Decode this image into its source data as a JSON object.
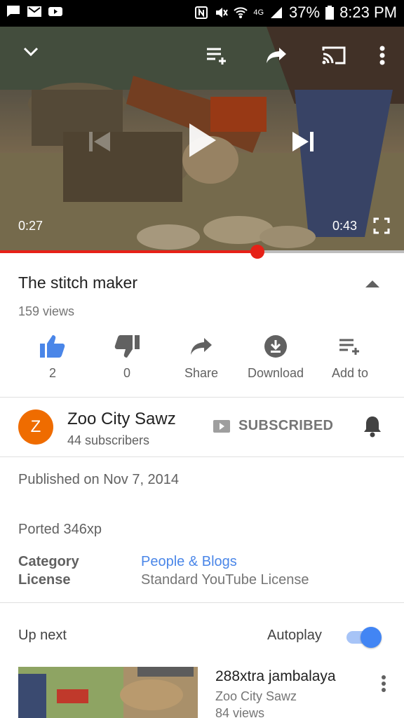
{
  "status_bar": {
    "battery": "37%",
    "time": "8:23 PM",
    "network": "4G"
  },
  "player": {
    "current_time": "0:27",
    "duration": "0:43",
    "progress_fraction": 0.638,
    "icons": [
      "chevron-down-icon",
      "add-to-playlist-icon",
      "share-icon",
      "cast-icon",
      "more-vert-icon",
      "previous-icon",
      "play-icon",
      "next-icon",
      "fullscreen-icon"
    ]
  },
  "video": {
    "title": "The stitch maker",
    "views": "159 views"
  },
  "actions": {
    "like_count": "2",
    "dislike_count": "0",
    "share": "Share",
    "download": "Download",
    "add_to": "Add to"
  },
  "channel": {
    "avatar_letter": "Z",
    "name": "Zoo City Sawz",
    "subscribers": "44 subscribers",
    "subscribed_label": "SUBSCRIBED"
  },
  "description": {
    "published": "Published on Nov 7, 2014",
    "text": "Ported 346xp",
    "category_key": "Category",
    "category_value": "People & Blogs",
    "license_key": "License",
    "license_value": "Standard YouTube License"
  },
  "up_next": {
    "label": "Up next",
    "autoplay_label": "Autoplay",
    "autoplay_on": true,
    "item": {
      "title": "288xtra jambalaya",
      "channel": "Zoo City Sawz",
      "views": "84 views"
    }
  },
  "colors": {
    "accent_blue": "#4a86e8",
    "progress_red": "#e62117",
    "avatar_orange": "#ef6c00"
  }
}
